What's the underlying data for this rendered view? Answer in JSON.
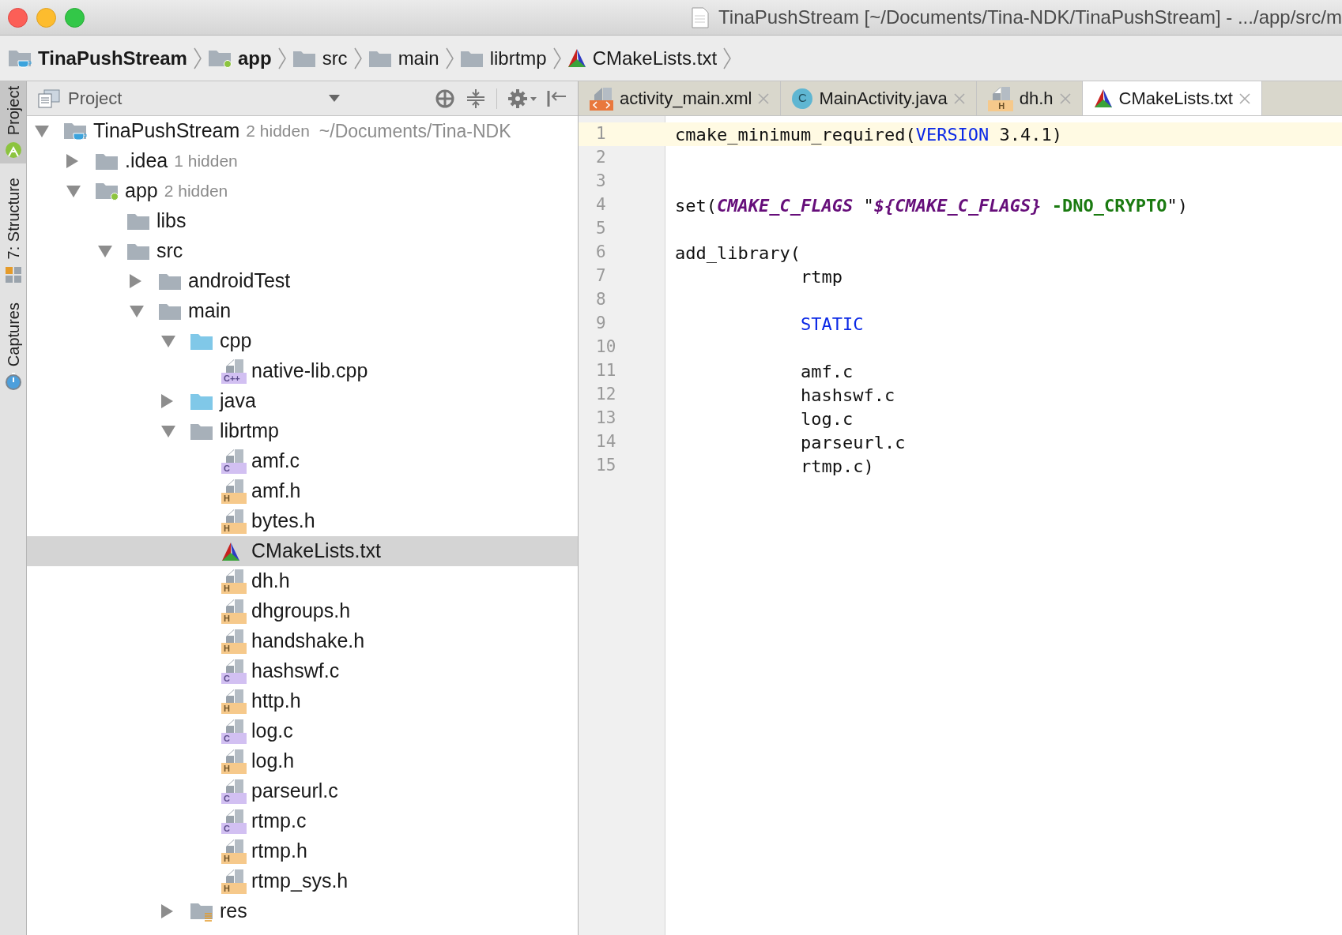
{
  "window": {
    "title": "TinaPushStream [~/Documents/Tina-NDK/TinaPushStream] - .../app/src/m"
  },
  "breadcrumbs": [
    {
      "label": "TinaPushStream",
      "kind": "project"
    },
    {
      "label": "app",
      "kind": "module"
    },
    {
      "label": "src",
      "kind": "folder"
    },
    {
      "label": "main",
      "kind": "folder"
    },
    {
      "label": "librtmp",
      "kind": "folder"
    },
    {
      "label": "CMakeLists.txt",
      "kind": "cmake"
    }
  ],
  "tool_stripe": [
    {
      "label": "Project",
      "kind": "project",
      "selected": true
    },
    {
      "label": "7: Structure",
      "kind": "structure",
      "selected": false
    },
    {
      "label": "Captures",
      "kind": "captures",
      "selected": false
    }
  ],
  "project_panel": {
    "title": "Project"
  },
  "tree": [
    {
      "label": "TinaPushStream",
      "kind": "project",
      "hidden": "2 hidden",
      "path": "~/Documents/Tina-NDK",
      "expanded": true,
      "selected": false,
      "children": [
        {
          "label": ".idea",
          "kind": "folder",
          "hidden": "1 hidden",
          "expanded": false,
          "selected": false
        },
        {
          "label": "app",
          "kind": "module",
          "hidden": "2 hidden",
          "expanded": true,
          "selected": false,
          "children": [
            {
              "label": "libs",
              "kind": "folder",
              "selected": false
            },
            {
              "label": "src",
              "kind": "folder",
              "expanded": true,
              "selected": false,
              "children": [
                {
                  "label": "androidTest",
                  "kind": "folder",
                  "expanded": false,
                  "selected": false
                },
                {
                  "label": "main",
                  "kind": "folder",
                  "expanded": true,
                  "selected": false,
                  "children": [
                    {
                      "label": "cpp",
                      "kind": "source-folder",
                      "expanded": true,
                      "selected": false,
                      "children": [
                        {
                          "label": "native-lib.cpp",
                          "kind": "cpp",
                          "badge": "C++",
                          "selected": false
                        }
                      ]
                    },
                    {
                      "label": "java",
                      "kind": "source-folder",
                      "expanded": false,
                      "selected": false
                    },
                    {
                      "label": "librtmp",
                      "kind": "folder",
                      "expanded": true,
                      "selected": false,
                      "children": [
                        {
                          "label": "amf.c",
                          "kind": "c",
                          "badge": "C",
                          "selected": false
                        },
                        {
                          "label": "amf.h",
                          "kind": "h",
                          "badge": "H",
                          "selected": false
                        },
                        {
                          "label": "bytes.h",
                          "kind": "h",
                          "badge": "H",
                          "selected": false
                        },
                        {
                          "label": "CMakeLists.txt",
                          "kind": "cmake",
                          "selected": true
                        },
                        {
                          "label": "dh.h",
                          "kind": "h",
                          "badge": "H",
                          "selected": false
                        },
                        {
                          "label": "dhgroups.h",
                          "kind": "h",
                          "badge": "H",
                          "selected": false
                        },
                        {
                          "label": "handshake.h",
                          "kind": "h",
                          "badge": "H",
                          "selected": false
                        },
                        {
                          "label": "hashswf.c",
                          "kind": "c",
                          "badge": "C",
                          "selected": false
                        },
                        {
                          "label": "http.h",
                          "kind": "h",
                          "badge": "H",
                          "selected": false
                        },
                        {
                          "label": "log.c",
                          "kind": "c",
                          "badge": "C",
                          "selected": false
                        },
                        {
                          "label": "log.h",
                          "kind": "h",
                          "badge": "H",
                          "selected": false
                        },
                        {
                          "label": "parseurl.c",
                          "kind": "c",
                          "badge": "C",
                          "selected": false
                        },
                        {
                          "label": "rtmp.c",
                          "kind": "c",
                          "badge": "C",
                          "selected": false
                        },
                        {
                          "label": "rtmp.h",
                          "kind": "h",
                          "badge": "H",
                          "selected": false
                        },
                        {
                          "label": "rtmp_sys.h",
                          "kind": "h",
                          "badge": "H",
                          "selected": false
                        }
                      ]
                    },
                    {
                      "label": "res",
                      "kind": "res-folder",
                      "expanded": false,
                      "selected": false
                    }
                  ]
                }
              ]
            }
          ]
        }
      ]
    }
  ],
  "editor_tabs": [
    {
      "label": "activity_main.xml",
      "kind": "xml",
      "selected": false
    },
    {
      "label": "MainActivity.java",
      "kind": "java",
      "badge": "C",
      "selected": false
    },
    {
      "label": "dh.h",
      "kind": "h",
      "badge": "H",
      "selected": false
    },
    {
      "label": "CMakeLists.txt",
      "kind": "cmake",
      "selected": true
    }
  ],
  "code": [
    {
      "number": "1",
      "current": true,
      "tokens": [
        {
          "text": "cmake_minimum_required(",
          "kind": "plain"
        },
        {
          "text": "VERSION",
          "kind": "keyword"
        },
        {
          "text": " 3.4.1)",
          "kind": "plain"
        }
      ]
    },
    {
      "number": "2",
      "current": false
    },
    {
      "number": "3",
      "current": false
    },
    {
      "number": "4",
      "current": false,
      "tokens": [
        {
          "text": "set(",
          "kind": "plain"
        },
        {
          "text": "CMAKE_C_FLAGS",
          "kind": "variable"
        },
        {
          "text": " \"",
          "kind": "plain"
        },
        {
          "text": "${CMAKE_C_FLAGS}",
          "kind": "variable"
        },
        {
          "text": " -DNO_CRYPTO",
          "kind": "string"
        },
        {
          "text": "\")",
          "kind": "plain"
        }
      ]
    },
    {
      "number": "5",
      "current": false
    },
    {
      "number": "6",
      "current": false,
      "tokens": [
        {
          "text": "add_library(",
          "kind": "plain"
        }
      ]
    },
    {
      "number": "7",
      "current": false,
      "tokens": [
        {
          "text": "            rtmp",
          "kind": "plain"
        }
      ]
    },
    {
      "number": "8",
      "current": false
    },
    {
      "number": "9",
      "current": false,
      "tokens": [
        {
          "text": "            STATIC",
          "kind": "keyword"
        }
      ]
    },
    {
      "number": "10",
      "current": false
    },
    {
      "number": "11",
      "current": false,
      "tokens": [
        {
          "text": "            amf.c",
          "kind": "plain"
        }
      ]
    },
    {
      "number": "12",
      "current": false,
      "tokens": [
        {
          "text": "            hashswf.c",
          "kind": "plain"
        }
      ]
    },
    {
      "number": "13",
      "current": false,
      "tokens": [
        {
          "text": "            log.c",
          "kind": "plain"
        }
      ]
    },
    {
      "number": "14",
      "current": false,
      "tokens": [
        {
          "text": "            parseurl.c",
          "kind": "plain"
        }
      ]
    },
    {
      "number": "15",
      "current": false,
      "tokens": [
        {
          "text": "            rtmp.c)",
          "kind": "plain"
        }
      ]
    }
  ]
}
